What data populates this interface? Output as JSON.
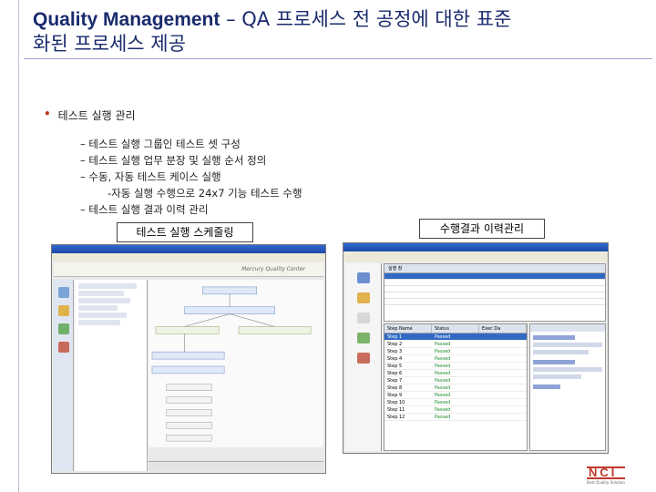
{
  "title": {
    "line1_en": "Quality Management",
    "line1_rest": " – QA 프로세스 전 공정에 대한 표준",
    "line2": "화된 프로세스 제공"
  },
  "main_bullet": "테스트 실행 관리",
  "sub_items": [
    "– 테스트 실행 그룹인 테스트 셋 구성",
    "– 테스트 실행 업무 분장 및 실행 순서 정의",
    "– 수동, 자동 테스트 케이스 실행",
    "-자동 실행 수행으로 24x7 기능 테스트 수행",
    "– 테스트 실행 결과 이력 관리"
  ],
  "captions": {
    "left": "테스트 실행 스케줄링",
    "right": "수행결과 이력관리"
  },
  "screenshot_left": {
    "product": "Mercury Quality Center"
  },
  "screenshot_right": {
    "filter": "실행 창",
    "steps_header": [
      "Step Name",
      "Status",
      "Exec Da"
    ],
    "steps": [
      {
        "name": "Step 1",
        "status": "Passed"
      },
      {
        "name": "Step 2",
        "status": "Passed"
      },
      {
        "name": "Step 3",
        "status": "Passed"
      },
      {
        "name": "Step 4",
        "status": "Passed"
      },
      {
        "name": "Step 5",
        "status": "Passed"
      },
      {
        "name": "Step 6",
        "status": "Passed"
      },
      {
        "name": "Step 7",
        "status": "Passed"
      },
      {
        "name": "Step 8",
        "status": "Passed"
      },
      {
        "name": "Step 9",
        "status": "Passed"
      },
      {
        "name": "Step 10",
        "status": "Passed"
      },
      {
        "name": "Step 11",
        "status": "Passed"
      },
      {
        "name": "Step 12",
        "status": "Passed"
      }
    ]
  },
  "logo": {
    "mark": "NCI",
    "tag": "Best Quality Solution"
  },
  "colors": {
    "title": "#1a2b6d",
    "bullet_dot": "#c0392b",
    "logo": "#c0392b",
    "selection": "#316ac5"
  }
}
